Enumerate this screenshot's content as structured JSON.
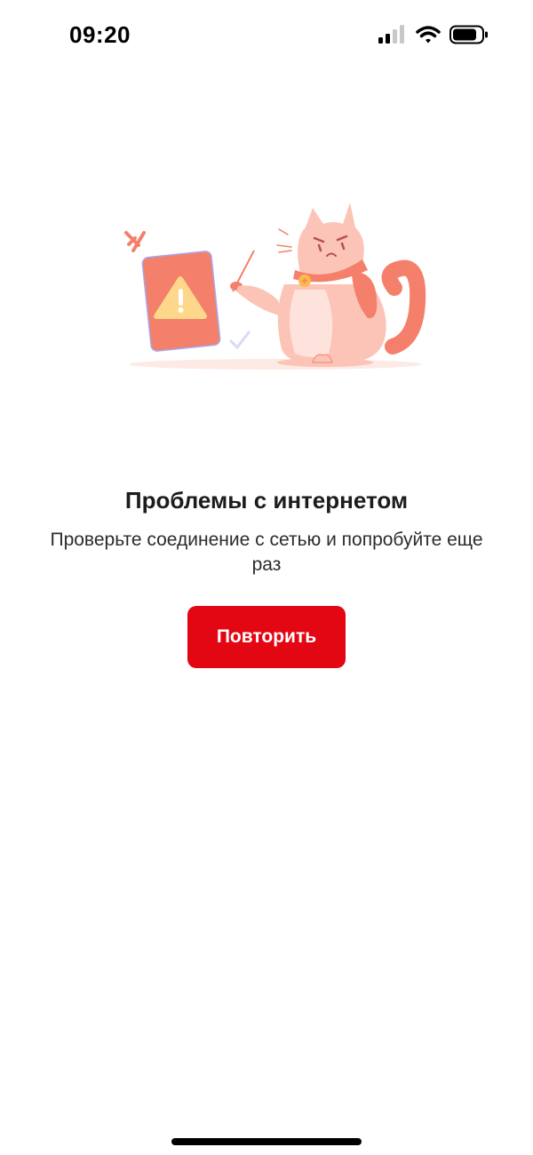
{
  "status_bar": {
    "time": "09:20",
    "icons": [
      "cellular-signal-icon",
      "wifi-icon",
      "battery-icon"
    ]
  },
  "illustration": {
    "icons": [
      "phone-warning-icon",
      "cat-icon"
    ]
  },
  "error": {
    "title": "Проблемы с интернетом",
    "message": "Проверьте соединение с сетью и попробуйте еще раз"
  },
  "actions": {
    "retry_label": "Повторить"
  },
  "colors": {
    "accent": "#e30613",
    "illustration_primary": "#f4806b",
    "illustration_light": "#fbc4b6",
    "warning": "#fdd78a"
  }
}
